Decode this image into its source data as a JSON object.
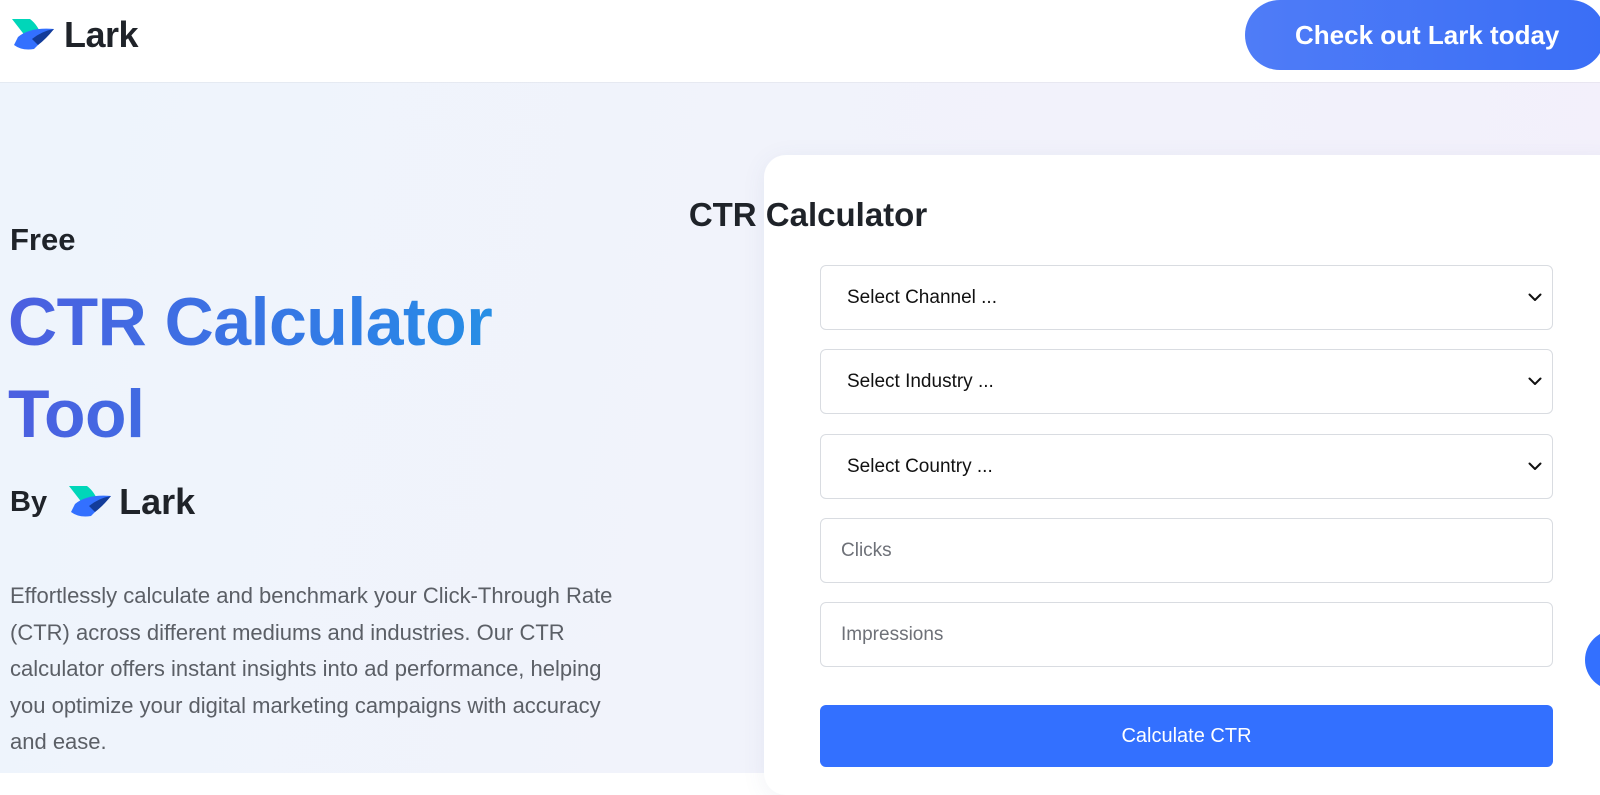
{
  "header": {
    "logo_text": "Lark",
    "cta_label": "Check out Lark today"
  },
  "hero": {
    "eyebrow": "Free",
    "title_line1": "CTR Calculator",
    "title_line2": "Tool",
    "by_label": "By",
    "by_logo_text": "Lark",
    "description": "Effortlessly calculate and benchmark your Click-Through Rate (CTR) across different mediums and industries. Our CTR calculator offers instant insights into ad performance, helping you optimize your digital marketing campaigns with accuracy and ease."
  },
  "calculator": {
    "title": "CTR Calculator",
    "channel_select": "Select Channel ...",
    "industry_select": "Select Industry ...",
    "country_select": "Select Country ...",
    "clicks_placeholder": "Clicks",
    "impressions_placeholder": "Impressions",
    "submit_label": "Calculate CTR"
  },
  "colors": {
    "primary_blue": "#3370ff",
    "cta_blue": "#4f7cf7",
    "title_gradient_start": "#4c5fe0",
    "title_gradient_end": "#1f9de4",
    "text_dark": "#1f2329",
    "text_muted": "#5b5f66"
  },
  "icons": {
    "logo": "lark-logo-icon",
    "select_arrow": "chevron-down-icon",
    "chat": "chat-bubble-icon"
  }
}
